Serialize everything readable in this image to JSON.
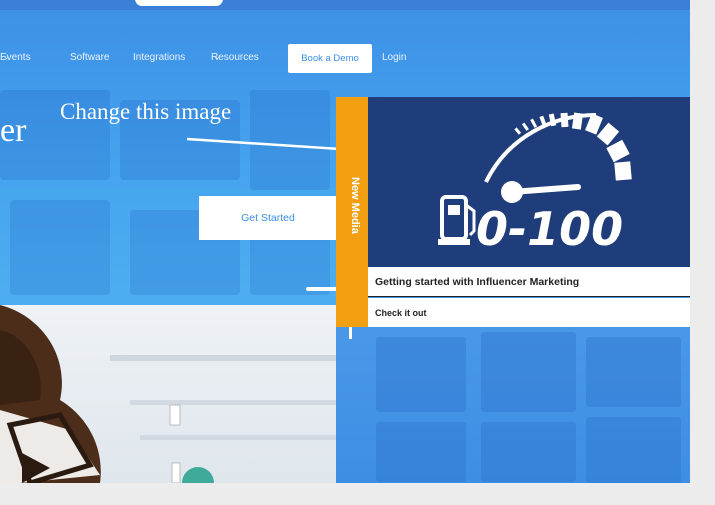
{
  "nav": {
    "items": [
      {
        "label": "Events",
        "has_dropdown": true
      },
      {
        "label": "Software",
        "has_dropdown": false
      },
      {
        "label": "Integrations",
        "has_dropdown": false
      },
      {
        "label": "Resources",
        "has_dropdown": true
      }
    ],
    "book_demo": "Book a Demo",
    "login": "Login",
    "dropdown_glyph": "⌄"
  },
  "hero": {
    "partial_heading": "er",
    "cta": "Get Started"
  },
  "annotation": {
    "text": "Change this image"
  },
  "card": {
    "side_tab": "New Media",
    "image_text": "0-100",
    "title": "Getting started with Influencer Marketing",
    "cta": "Check it out"
  },
  "colors": {
    "accent_orange": "#f29f12",
    "card_navy": "#1f3d7a",
    "brand_blue": "#3b8fe6"
  },
  "icons": [
    "speedometer-icon",
    "fuel-pump-icon",
    "play-icon",
    "dropdown-chevron-icon"
  ]
}
